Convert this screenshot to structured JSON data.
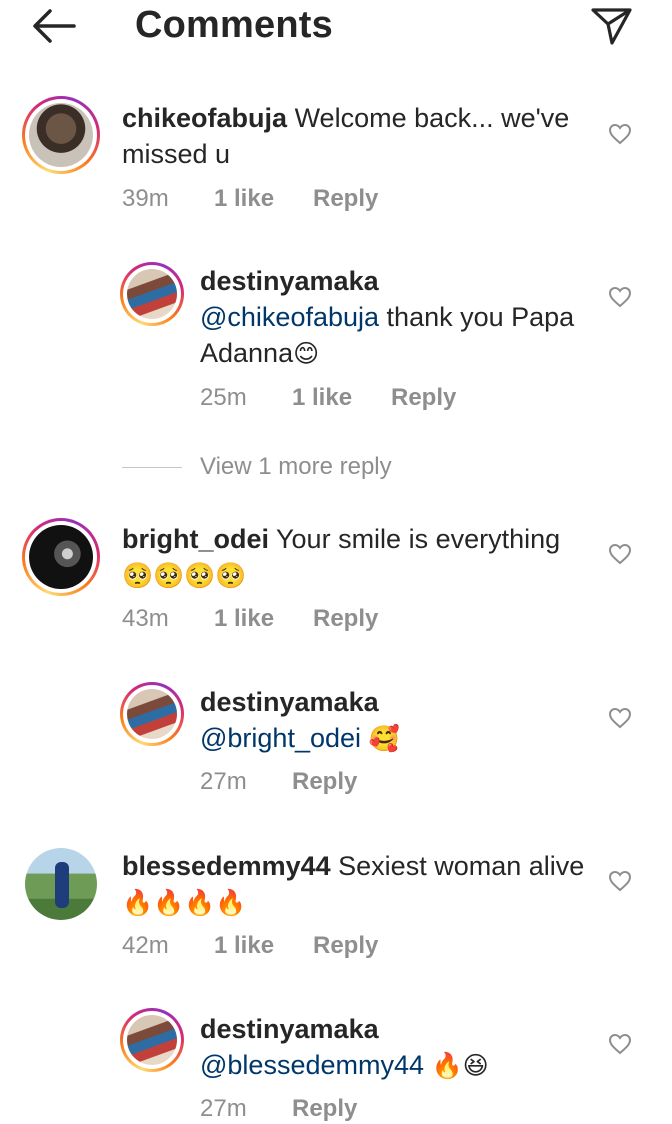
{
  "header": {
    "title": "Comments"
  },
  "view_more_replies": "View 1 more reply",
  "comments": [
    {
      "username": "chikeofabuja",
      "text": "Welcome back... we've missed u",
      "time": "39m",
      "likes": "1 like",
      "reply": "Reply",
      "replies": [
        {
          "username": "destinyamaka",
          "mention": "@chikeofabuja",
          "text": "thank you Papa Adanna",
          "emoji": "😊",
          "time": "25m",
          "likes": "1 like",
          "reply": "Reply"
        }
      ]
    },
    {
      "username": "bright_odei",
      "text": "Your smile is everything",
      "emoji": "🥺🥺🥺🥺",
      "time": "43m",
      "likes": "1 like",
      "reply": "Reply",
      "replies": [
        {
          "username": "destinyamaka",
          "mention": "@bright_odei",
          "emoji": "🥰",
          "time": "27m",
          "reply": "Reply"
        }
      ]
    },
    {
      "username": "blessedemmy44",
      "text": "Sexiest woman alive",
      "emoji": "🔥🔥🔥🔥",
      "time": "42m",
      "likes": "1 like",
      "reply": "Reply",
      "replies": [
        {
          "username": "destinyamaka",
          "mention": "@blessedemmy44",
          "emoji": "🔥😆",
          "time": "27m",
          "reply": "Reply"
        }
      ]
    }
  ],
  "colors": {
    "text": "#262626",
    "secondary": "#8e8e8e",
    "mention": "#00376b",
    "story_ring_start": "#feda75",
    "story_ring_end": "#d62976"
  },
  "icons": [
    "back-arrow-icon",
    "send-icon",
    "heart-icon"
  ]
}
